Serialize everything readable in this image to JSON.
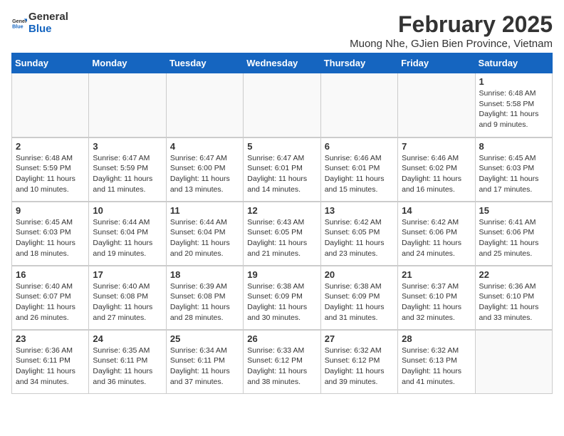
{
  "logo": {
    "text_general": "General",
    "text_blue": "Blue"
  },
  "title": "February 2025",
  "subtitle": "Muong Nhe, GJien Bien Province, Vietnam",
  "headers": [
    "Sunday",
    "Monday",
    "Tuesday",
    "Wednesday",
    "Thursday",
    "Friday",
    "Saturday"
  ],
  "weeks": [
    [
      {
        "day": "",
        "info": ""
      },
      {
        "day": "",
        "info": ""
      },
      {
        "day": "",
        "info": ""
      },
      {
        "day": "",
        "info": ""
      },
      {
        "day": "",
        "info": ""
      },
      {
        "day": "",
        "info": ""
      },
      {
        "day": "1",
        "info": "Sunrise: 6:48 AM\nSunset: 5:58 PM\nDaylight: 11 hours\nand 9 minutes."
      }
    ],
    [
      {
        "day": "2",
        "info": "Sunrise: 6:48 AM\nSunset: 5:59 PM\nDaylight: 11 hours\nand 10 minutes."
      },
      {
        "day": "3",
        "info": "Sunrise: 6:47 AM\nSunset: 5:59 PM\nDaylight: 11 hours\nand 11 minutes."
      },
      {
        "day": "4",
        "info": "Sunrise: 6:47 AM\nSunset: 6:00 PM\nDaylight: 11 hours\nand 13 minutes."
      },
      {
        "day": "5",
        "info": "Sunrise: 6:47 AM\nSunset: 6:01 PM\nDaylight: 11 hours\nand 14 minutes."
      },
      {
        "day": "6",
        "info": "Sunrise: 6:46 AM\nSunset: 6:01 PM\nDaylight: 11 hours\nand 15 minutes."
      },
      {
        "day": "7",
        "info": "Sunrise: 6:46 AM\nSunset: 6:02 PM\nDaylight: 11 hours\nand 16 minutes."
      },
      {
        "day": "8",
        "info": "Sunrise: 6:45 AM\nSunset: 6:03 PM\nDaylight: 11 hours\nand 17 minutes."
      }
    ],
    [
      {
        "day": "9",
        "info": "Sunrise: 6:45 AM\nSunset: 6:03 PM\nDaylight: 11 hours\nand 18 minutes."
      },
      {
        "day": "10",
        "info": "Sunrise: 6:44 AM\nSunset: 6:04 PM\nDaylight: 11 hours\nand 19 minutes."
      },
      {
        "day": "11",
        "info": "Sunrise: 6:44 AM\nSunset: 6:04 PM\nDaylight: 11 hours\nand 20 minutes."
      },
      {
        "day": "12",
        "info": "Sunrise: 6:43 AM\nSunset: 6:05 PM\nDaylight: 11 hours\nand 21 minutes."
      },
      {
        "day": "13",
        "info": "Sunrise: 6:42 AM\nSunset: 6:05 PM\nDaylight: 11 hours\nand 23 minutes."
      },
      {
        "day": "14",
        "info": "Sunrise: 6:42 AM\nSunset: 6:06 PM\nDaylight: 11 hours\nand 24 minutes."
      },
      {
        "day": "15",
        "info": "Sunrise: 6:41 AM\nSunset: 6:06 PM\nDaylight: 11 hours\nand 25 minutes."
      }
    ],
    [
      {
        "day": "16",
        "info": "Sunrise: 6:40 AM\nSunset: 6:07 PM\nDaylight: 11 hours\nand 26 minutes."
      },
      {
        "day": "17",
        "info": "Sunrise: 6:40 AM\nSunset: 6:08 PM\nDaylight: 11 hours\nand 27 minutes."
      },
      {
        "day": "18",
        "info": "Sunrise: 6:39 AM\nSunset: 6:08 PM\nDaylight: 11 hours\nand 28 minutes."
      },
      {
        "day": "19",
        "info": "Sunrise: 6:38 AM\nSunset: 6:09 PM\nDaylight: 11 hours\nand 30 minutes."
      },
      {
        "day": "20",
        "info": "Sunrise: 6:38 AM\nSunset: 6:09 PM\nDaylight: 11 hours\nand 31 minutes."
      },
      {
        "day": "21",
        "info": "Sunrise: 6:37 AM\nSunset: 6:10 PM\nDaylight: 11 hours\nand 32 minutes."
      },
      {
        "day": "22",
        "info": "Sunrise: 6:36 AM\nSunset: 6:10 PM\nDaylight: 11 hours\nand 33 minutes."
      }
    ],
    [
      {
        "day": "23",
        "info": "Sunrise: 6:36 AM\nSunset: 6:11 PM\nDaylight: 11 hours\nand 34 minutes."
      },
      {
        "day": "24",
        "info": "Sunrise: 6:35 AM\nSunset: 6:11 PM\nDaylight: 11 hours\nand 36 minutes."
      },
      {
        "day": "25",
        "info": "Sunrise: 6:34 AM\nSunset: 6:11 PM\nDaylight: 11 hours\nand 37 minutes."
      },
      {
        "day": "26",
        "info": "Sunrise: 6:33 AM\nSunset: 6:12 PM\nDaylight: 11 hours\nand 38 minutes."
      },
      {
        "day": "27",
        "info": "Sunrise: 6:32 AM\nSunset: 6:12 PM\nDaylight: 11 hours\nand 39 minutes."
      },
      {
        "day": "28",
        "info": "Sunrise: 6:32 AM\nSunset: 6:13 PM\nDaylight: 11 hours\nand 41 minutes."
      },
      {
        "day": "",
        "info": ""
      }
    ]
  ]
}
